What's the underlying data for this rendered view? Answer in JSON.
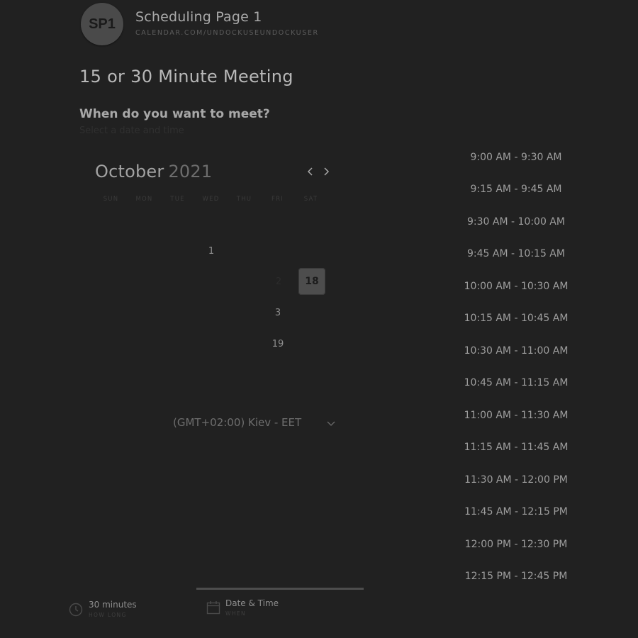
{
  "header": {
    "avatar_initials": "SP1",
    "title": "Scheduling Page 1",
    "url": "CALENDAR.COM/UNDOCKUSEUNDOCKUSER"
  },
  "meeting": {
    "title": "15 or 30 Minute Meeting",
    "prompt": "When do you want to meet?",
    "prompt_sub": "Select a date and time"
  },
  "calendar": {
    "month": "October",
    "year": "2021",
    "prev_icon": "chevron-left-icon",
    "next_icon": "chevron-right-icon",
    "weekdays": [
      "SUN",
      "MON",
      "TUE",
      "WED",
      "THU",
      "FRI",
      "SAT"
    ],
    "days": [
      {
        "label": "1",
        "state": "available"
      },
      {
        "label": "2",
        "state": "disabled"
      },
      {
        "label": "3",
        "state": "available"
      },
      {
        "label": "18",
        "state": "selected"
      },
      {
        "label": "19",
        "state": "available"
      }
    ],
    "timezone": "(GMT+02:00) Kiev - EET",
    "timezone_icon": "chevron-down-icon"
  },
  "time_slots": [
    "9:00 AM - 9:30 AM",
    "9:15 AM - 9:45 AM",
    "9:30 AM - 10:00 AM",
    "9:45 AM - 10:15 AM",
    "10:00 AM - 10:30 AM",
    "10:15 AM - 10:45 AM",
    "10:30 AM - 11:00 AM",
    "10:45 AM - 11:15 AM",
    "11:00 AM - 11:30 AM",
    "11:15 AM - 11:45 AM",
    "11:30 AM - 12:00 PM",
    "11:45 AM - 12:15 PM",
    "12:00 PM - 12:30 PM",
    "12:15 PM - 12:45 PM"
  ],
  "footer": {
    "duration": {
      "title": "30 minutes",
      "subtitle": "HOW LONG",
      "icon": "clock-icon"
    },
    "datetime": {
      "title": "Date & Time",
      "subtitle": "WHEN",
      "icon": "calendar-icon"
    }
  },
  "colors": {
    "background": "#212121",
    "selected_day": "#4d4d4d",
    "active_step_bar": "#4d4d4d"
  }
}
